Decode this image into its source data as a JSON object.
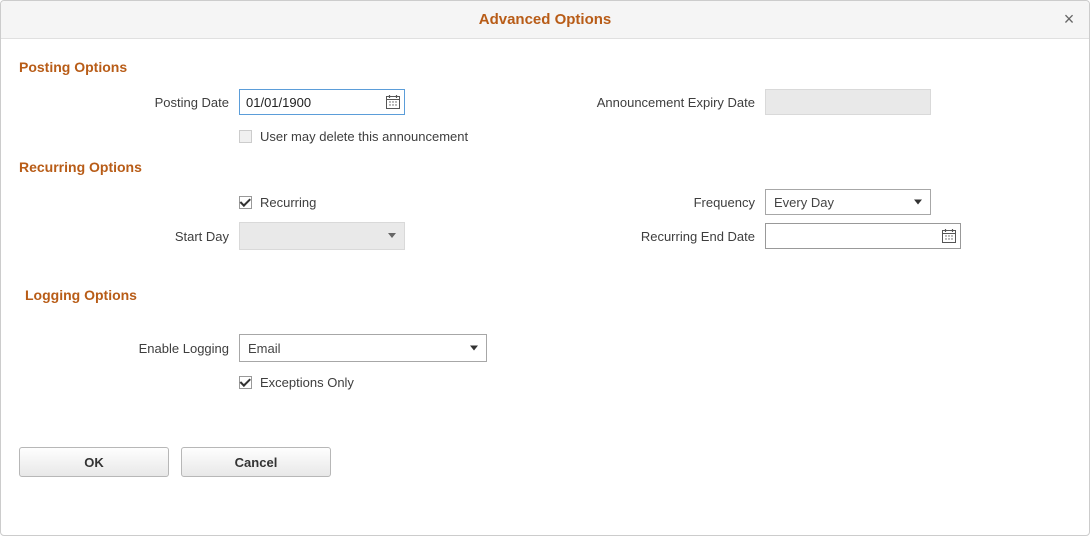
{
  "titlebar": {
    "title": "Advanced Options"
  },
  "posting": {
    "section_title": "Posting Options",
    "posting_date_label": "Posting Date",
    "posting_date_value": "01/01/1900",
    "expiry_label": "Announcement Expiry Date",
    "user_may_delete_label": "User may delete this announcement",
    "user_may_delete_checked": false
  },
  "recurring": {
    "section_title": "Recurring Options",
    "recurring_label": "Recurring",
    "recurring_checked": true,
    "frequency_label": "Frequency",
    "frequency_value": "Every Day",
    "start_day_label": "Start Day",
    "start_day_value": "",
    "end_date_label": "Recurring End Date",
    "end_date_value": ""
  },
  "logging": {
    "section_title": "Logging Options",
    "enable_logging_label": "Enable Logging",
    "enable_logging_value": "Email",
    "exceptions_only_label": "Exceptions Only",
    "exceptions_only_checked": true
  },
  "buttons": {
    "ok": "OK",
    "cancel": "Cancel"
  }
}
